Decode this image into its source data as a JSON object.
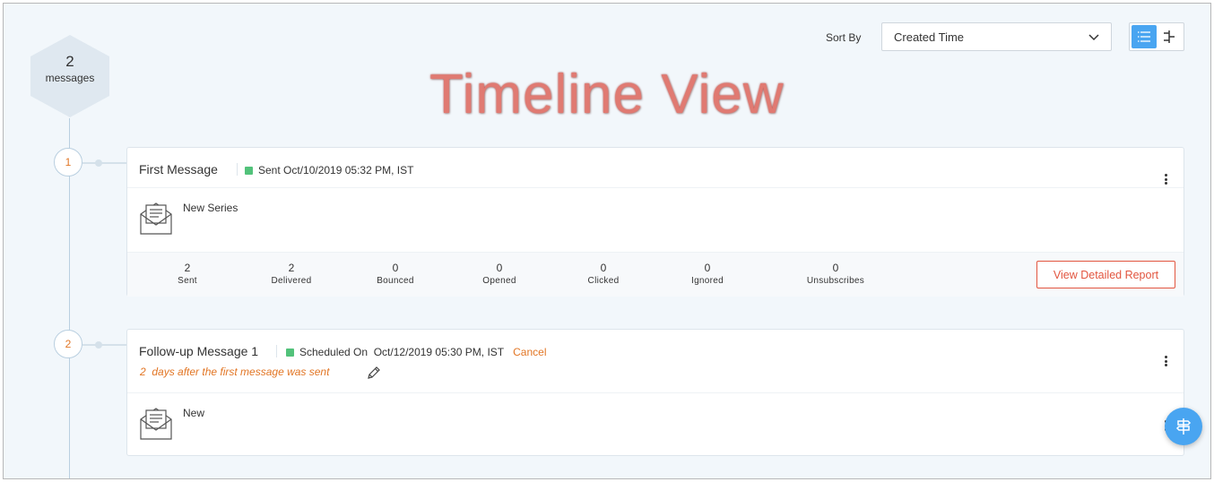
{
  "header": {
    "sort_label": "Sort By",
    "sort_value": "Created Time",
    "view_modes": [
      "list-view-icon",
      "timeline-view-icon"
    ],
    "active_view": "list-view-icon",
    "accent_color": "#49a5f1"
  },
  "watermark": "Timeline View",
  "summary": {
    "count": "2",
    "label": "messages"
  },
  "messages": [
    {
      "step": "1",
      "title": "First Message",
      "status": "Sent Oct/10/2019 05:32 PM, IST",
      "status_color": "#52c27a",
      "name": "New Series",
      "stats": [
        {
          "value": "2",
          "label": "Sent"
        },
        {
          "value": "2",
          "label": "Delivered"
        },
        {
          "value": "0",
          "label": "Bounced"
        },
        {
          "value": "0",
          "label": "Opened"
        },
        {
          "value": "0",
          "label": "Clicked"
        },
        {
          "value": "0",
          "label": "Ignored"
        },
        {
          "value": "0",
          "label": "Unsubscribes"
        }
      ],
      "report_button": "View Detailed Report"
    },
    {
      "step": "2",
      "title": "Follow-up Message 1",
      "status": "Scheduled On  Oct/12/2019 05:30 PM, IST",
      "status_color": "#52c27a",
      "cancel_label": "Cancel",
      "schedule_note": "2  days after the first message was sent",
      "name": "New"
    }
  ]
}
